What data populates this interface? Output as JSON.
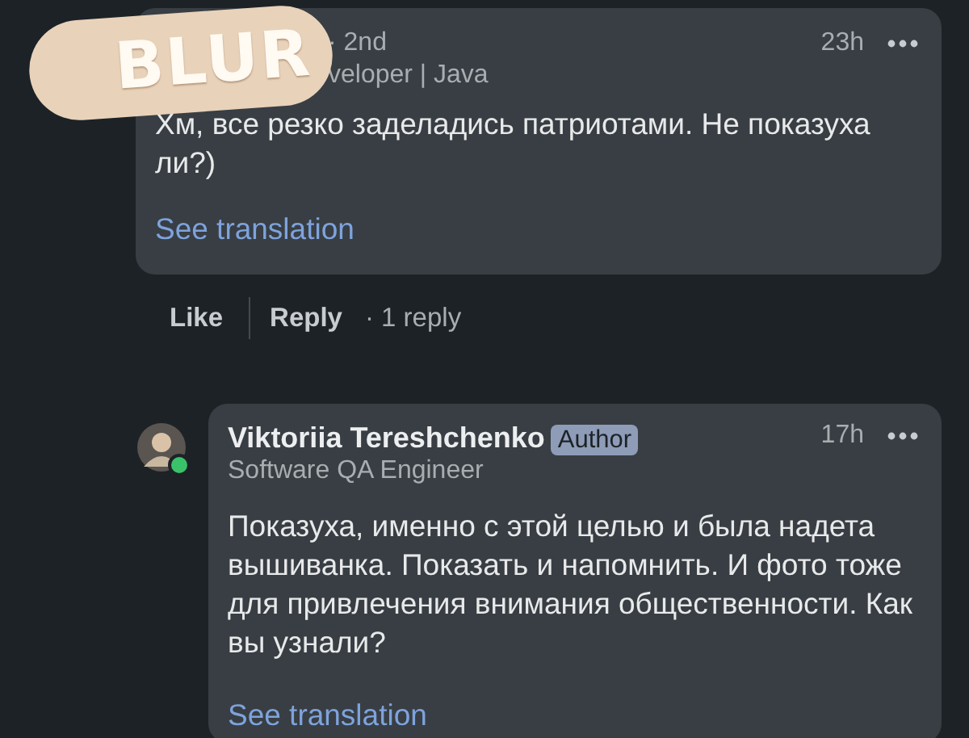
{
  "comment": {
    "sticker": "BLUR",
    "degree": "· 2nd",
    "headline": "veloper | Java",
    "time": "23h",
    "text": "Хм, все резко заделадись патриотами. Не показуха ли?)",
    "translate": "See translation"
  },
  "actions": {
    "like": "Like",
    "reply": "Reply",
    "replies": "· 1 reply"
  },
  "reply": {
    "name": "Viktoriia Tereshchenko",
    "badge": "Author",
    "online": true,
    "headline": "Software QA Engineer",
    "time": "17h",
    "text": "Показуха, именно с этой целью и была надета вышиванка. Показать и напомнить. И фото тоже для привлечения внимания общественности. Как вы узнали?",
    "translate": "See translation"
  }
}
